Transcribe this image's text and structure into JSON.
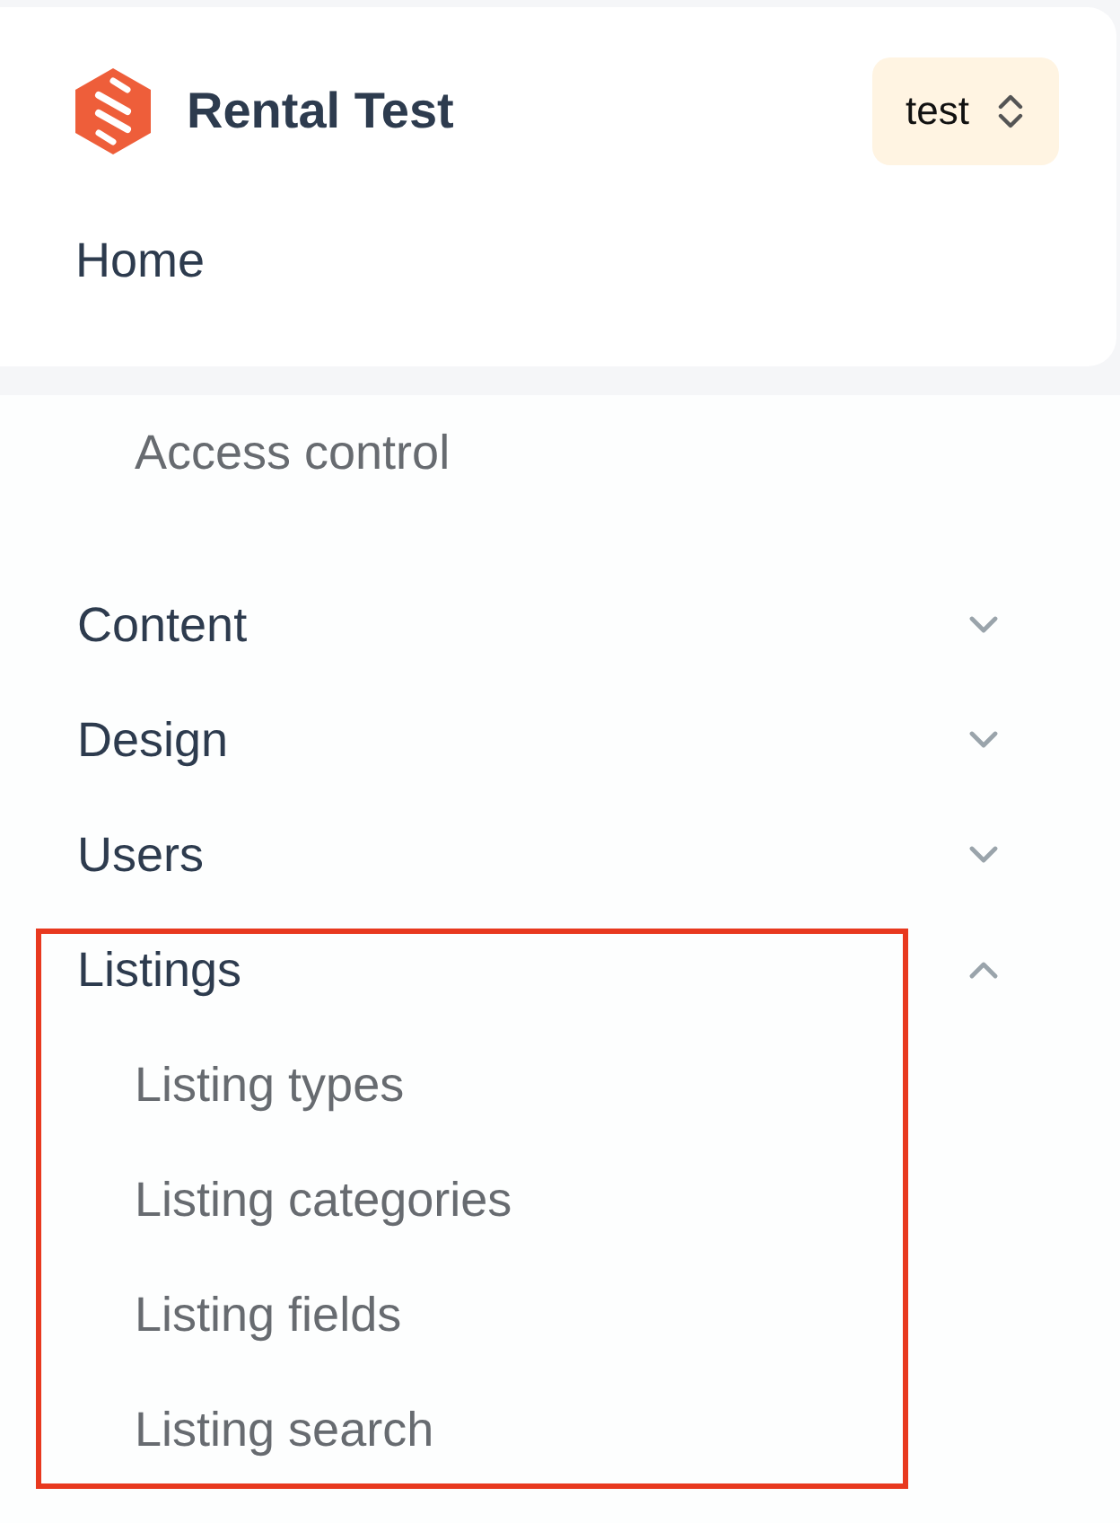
{
  "header": {
    "brand": "Rental Test",
    "switcher": {
      "label": "test"
    },
    "home": {
      "label": "Home"
    }
  },
  "nav": {
    "items": [
      {
        "label": "Access control"
      }
    ],
    "groups": [
      {
        "label": "Content",
        "expanded": false,
        "highlighted": false
      },
      {
        "label": "Design",
        "expanded": false,
        "highlighted": false
      },
      {
        "label": "Users",
        "expanded": false,
        "highlighted": false
      },
      {
        "label": "Listings",
        "expanded": true,
        "highlighted": true,
        "children": [
          {
            "label": "Listing types"
          },
          {
            "label": "Listing categories"
          },
          {
            "label": "Listing fields"
          },
          {
            "label": "Listing search"
          }
        ]
      }
    ]
  }
}
